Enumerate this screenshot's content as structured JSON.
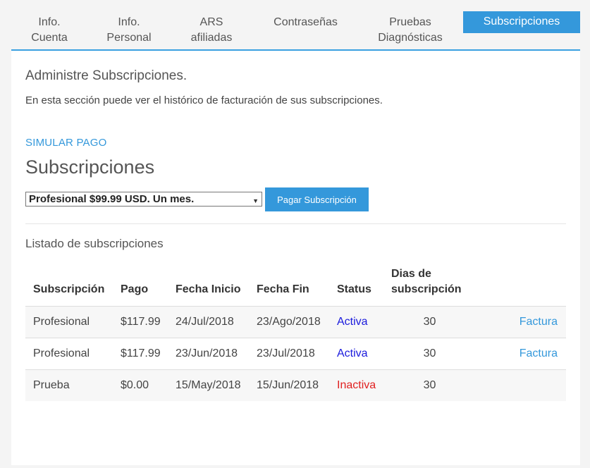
{
  "tabs": [
    {
      "line1": "Info.",
      "line2": "Cuenta"
    },
    {
      "line1": "Info.",
      "line2": "Personal"
    },
    {
      "line1": "ARS",
      "line2": "afiliadas"
    },
    {
      "line1": "Contraseñas",
      "line2": ""
    },
    {
      "line1": "Pruebas",
      "line2": "Diagnósticas"
    },
    {
      "line1": "Subscripciones",
      "line2": ""
    }
  ],
  "content": {
    "heading": "Administre Subscripciones.",
    "description": "En esta sección puede ver el histórico de facturación de sus subscripciones.",
    "simulate_link": "SIMULAR PAGO",
    "subs_title": "Subscripciones",
    "selected_plan": "Profesional $99.99 USD. Un mes.",
    "pay_button": "Pagar Subscripción",
    "list_title": "Listado de subscripciones"
  },
  "table": {
    "headers": [
      "Subscripción",
      "Pago",
      "Fecha Inicio",
      "Fecha Fin",
      "Status",
      "Dias de",
      "subscripción",
      ""
    ],
    "rows": [
      {
        "plan": "Profesional",
        "amount": "$117.99",
        "start": "24/Jul/2018",
        "end": "23/Ago/2018",
        "status": "Activa",
        "days": "30",
        "invoice": "Factura"
      },
      {
        "plan": "Profesional",
        "amount": "$117.99",
        "start": "23/Jun/2018",
        "end": "23/Jul/2018",
        "status": "Activa",
        "days": "30",
        "invoice": "Factura"
      },
      {
        "plan": "Prueba",
        "amount": "$0.00",
        "start": "15/May/2018",
        "end": "15/Jun/2018",
        "status": "Inactiva",
        "days": "30",
        "invoice": ""
      }
    ]
  },
  "colors": {
    "accent": "#3498db",
    "status_active": "#1a1adc",
    "status_inactive": "#e02020"
  }
}
